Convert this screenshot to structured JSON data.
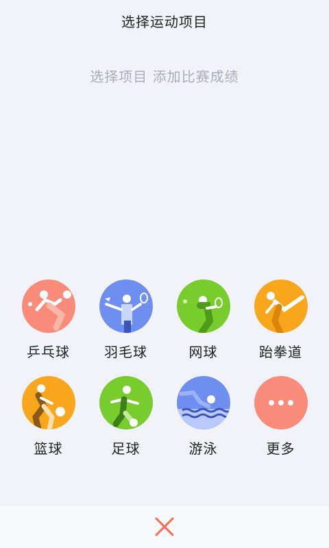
{
  "header": {
    "title": "选择运动项目"
  },
  "hint": "选择项目 添加比赛成绩",
  "sports": [
    {
      "label": "乒乓球",
      "icon": "table-tennis-icon",
      "color": "#f98b7a"
    },
    {
      "label": "羽毛球",
      "icon": "badminton-icon",
      "color": "#6e8ff0"
    },
    {
      "label": "网球",
      "icon": "tennis-icon",
      "color": "#78cc2e"
    },
    {
      "label": "跆拳道",
      "icon": "taekwondo-icon",
      "color": "#f8a61c"
    },
    {
      "label": "篮球",
      "icon": "basketball-icon",
      "color": "#f8a61c"
    },
    {
      "label": "足球",
      "icon": "football-icon",
      "color": "#78cc2e"
    },
    {
      "label": "游泳",
      "icon": "swimming-icon",
      "color": "#6e8ff0"
    },
    {
      "label": "更多",
      "icon": "more-icon",
      "color": "#f98b7a"
    }
  ],
  "footer": {
    "close_icon": "close-icon",
    "close_color": "#f36b4e"
  }
}
